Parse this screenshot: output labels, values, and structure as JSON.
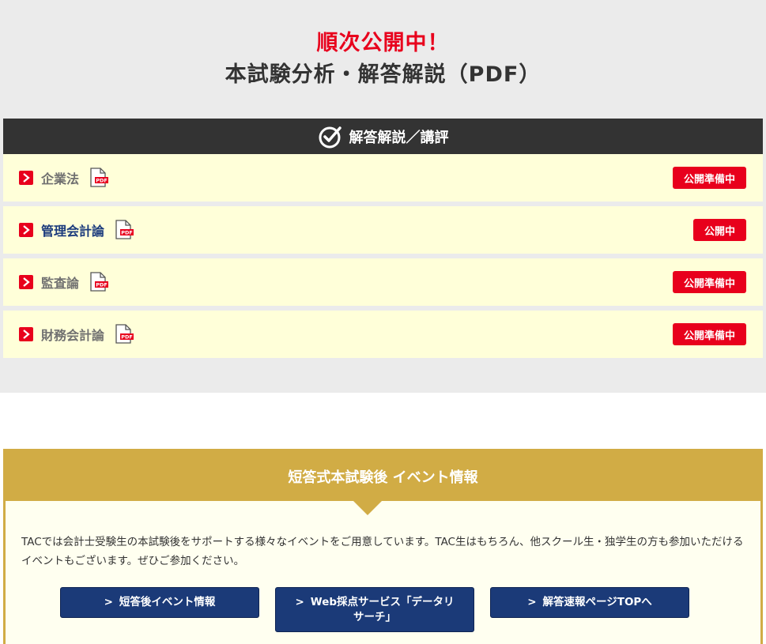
{
  "hero": {
    "headline_red": "順次公開中！",
    "headline_main": "本試験分析・解答解説（PDF）"
  },
  "panel": {
    "title": "解答解説／講評",
    "rows": [
      {
        "label": "企業法",
        "status": "公開準備中",
        "active": false
      },
      {
        "label": "管理会計論",
        "status": "公開中",
        "active": true
      },
      {
        "label": "監査論",
        "status": "公開準備中",
        "active": false
      },
      {
        "label": "財務会計論",
        "status": "公開準備中",
        "active": false
      }
    ],
    "pdf_icon_text": "PDF"
  },
  "event": {
    "title": "短答式本試験後 イベント情報",
    "description": "TACでは会計士受験生の本試験後をサポートする様々なイベントをご用意しています。TAC生はもちろん、他スクール生・独学生の方も参加いただけるイベントもございます。ぜひご参加ください。",
    "buttons": [
      {
        "label": "短答後イベント情報"
      },
      {
        "label": "Web採点サービス「データリサーチ」"
      },
      {
        "label": "解答速報ページTOPへ"
      }
    ]
  },
  "colors": {
    "accent_red": "#e8001c",
    "gold": "#d1ac45",
    "navy": "#1b3a78",
    "row_bg": "#ffffd9"
  },
  "icons": {
    "panel_head": "check-circle-icon",
    "row_arrow": "chevron-right-icon",
    "row_file": "pdf-file-icon"
  }
}
